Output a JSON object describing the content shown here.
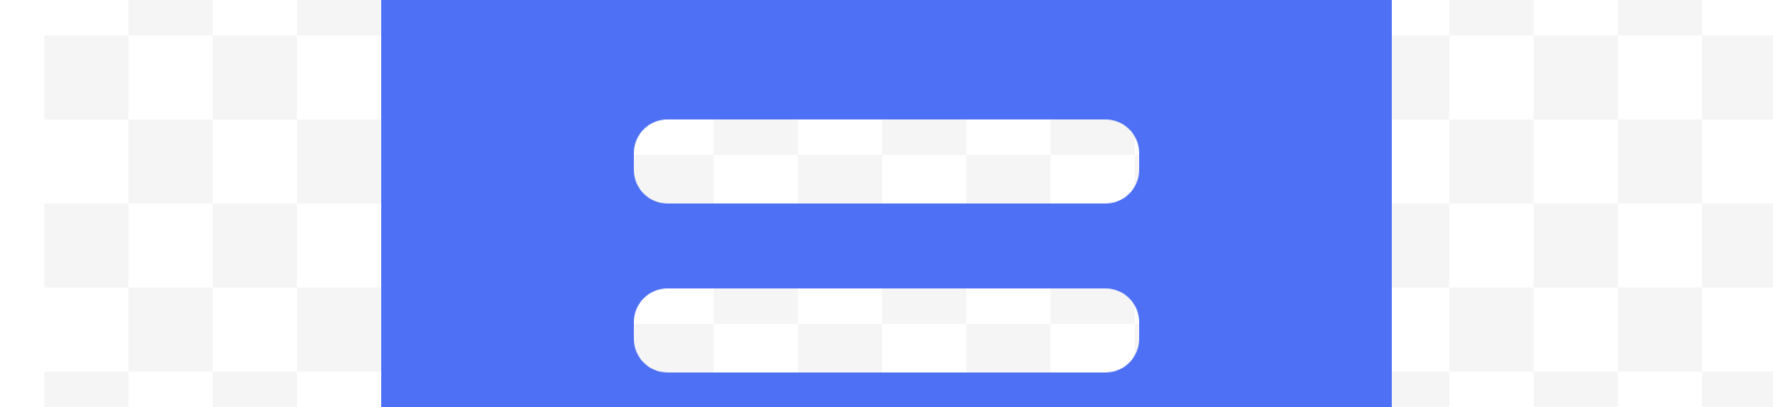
{
  "icon": {
    "name": "menu-icon",
    "bars": 2
  },
  "colors": {
    "accent": "#4d70f5",
    "transparency_light": "#ffffff",
    "transparency_dark": "#f5f5f5"
  }
}
